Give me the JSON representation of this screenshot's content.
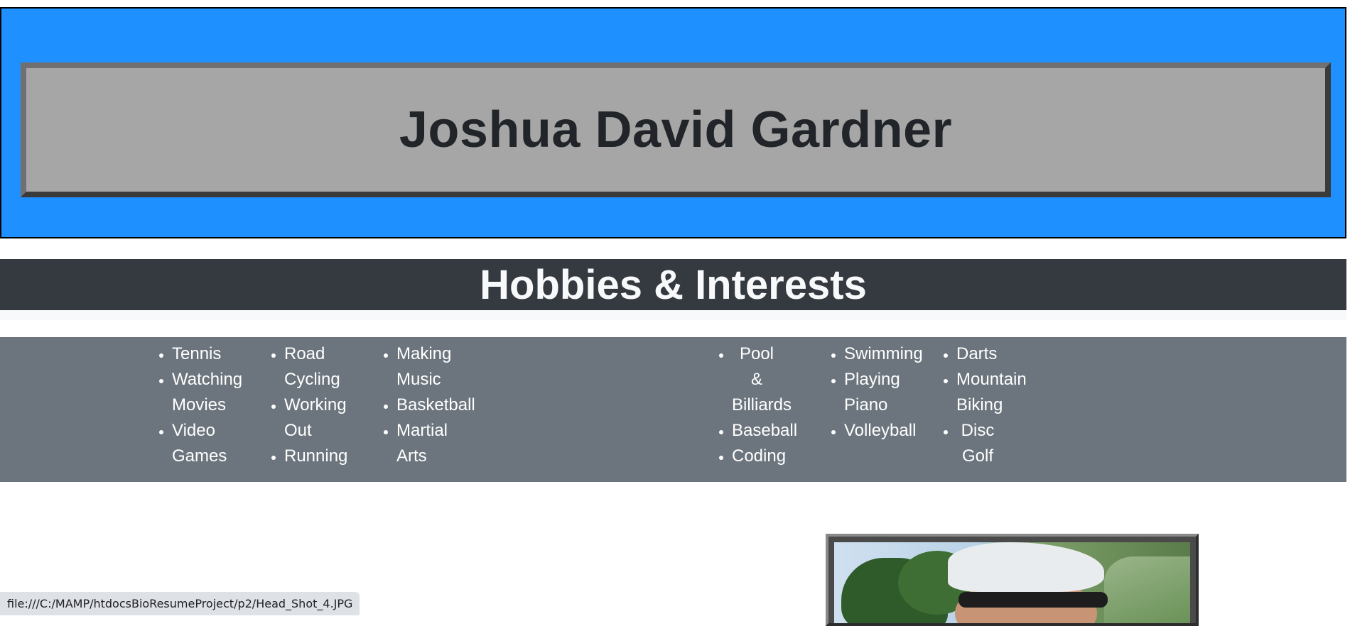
{
  "header": {
    "name": "Joshua David Gardner"
  },
  "hobbies_section": {
    "title": "Hobbies & Interests",
    "columns": [
      [
        "Tennis",
        "Watching Movies",
        "Video Games"
      ],
      [
        "Road Cycling",
        "Working Out",
        "Running"
      ],
      [
        "Making Music",
        "Basketball",
        "Martial Arts"
      ],
      [
        "Pool & Billiards",
        "Baseball",
        "Coding"
      ],
      [
        "Swimming",
        "Playing Piano",
        "Volleyball"
      ],
      [
        "Darts",
        "Mountain Biking",
        "Disc Golf"
      ]
    ]
  },
  "photo": {
    "subject": "head-shot-photo"
  },
  "status_bar": {
    "url": "file:///C:/MAMP/htdocsBioResumeProject/p2/Head_Shot_4.JPG"
  },
  "colors": {
    "header_bg": "#1e90ff",
    "name_box_bg": "#a6a6a6",
    "section_bar_bg": "#343a40",
    "hobbies_bg": "#6c757d"
  }
}
